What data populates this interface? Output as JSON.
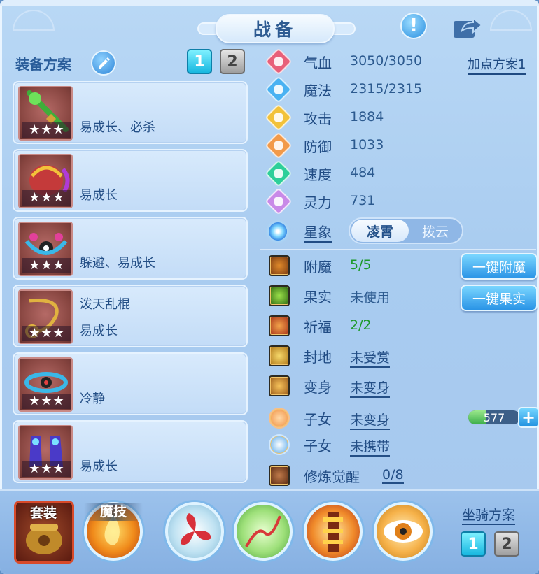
{
  "header": {
    "title": "战备"
  },
  "left": {
    "plan_label": "装备方案",
    "tabs": [
      "1",
      "2"
    ],
    "active_tab": "1",
    "slots": [
      {
        "name": "",
        "tag": "易成长、必杀",
        "stars": "★★★",
        "icon": "green-staff-weapon-icon"
      },
      {
        "name": "",
        "tag": "易成长",
        "stars": "★★★",
        "icon": "jeweled-helmet-icon"
      },
      {
        "name": "",
        "tag": "躲避、易成长",
        "stars": "★★★",
        "icon": "ornate-necklace-icon"
      },
      {
        "name": "泼天乱棍",
        "tag": "易成长",
        "stars": "★★★",
        "icon": "chain-weapon-icon"
      },
      {
        "name": "",
        "tag": "冷静",
        "stars": "★★★",
        "icon": "eye-belt-icon"
      },
      {
        "name": "",
        "tag": "易成长",
        "stars": "★★★",
        "icon": "boots-icon"
      }
    ]
  },
  "stats": {
    "add_plan": "加点方案1",
    "items": [
      {
        "name": "气血",
        "value": "3050/3050",
        "icon": "heart-gem-icon",
        "color": "#e8607a"
      },
      {
        "name": "魔法",
        "value": "2315/2315",
        "icon": "mana-gem-icon",
        "color": "#4ab2f2"
      },
      {
        "name": "攻击",
        "value": "1884",
        "icon": "sword-gem-icon",
        "color": "#f2c23a"
      },
      {
        "name": "防御",
        "value": "1033",
        "icon": "shield-gem-icon",
        "color": "#f29a4a"
      },
      {
        "name": "速度",
        "value": "484",
        "icon": "speed-gem-icon",
        "color": "#2ecf9a"
      },
      {
        "name": "灵力",
        "value": "731",
        "icon": "spirit-gem-icon",
        "color": "#c98ae8"
      }
    ],
    "xingxiang": {
      "label": "星象",
      "options": [
        "凌霄",
        "拨云"
      ],
      "selected": "凌霄"
    }
  },
  "extras": [
    {
      "name": "附魔",
      "value": "5/5",
      "style": "green"
    },
    {
      "name": "果实",
      "value": "未使用",
      "style": "plain"
    },
    {
      "name": "祈福",
      "value": "2/2",
      "style": "green"
    },
    {
      "name": "封地",
      "value": "未受赏",
      "style": "underline"
    },
    {
      "name": "变身",
      "value": "未变身",
      "style": "underline"
    },
    {
      "name": "子女",
      "value": "未变身",
      "style": "underline"
    },
    {
      "name": "子女",
      "value": "未携带",
      "style": "underline"
    },
    {
      "name": "修炼觉醒",
      "value": "0/8",
      "style": "underline"
    }
  ],
  "actions": {
    "enchant": "一键附魔",
    "fruit": "一键果实"
  },
  "exp": {
    "value": "577",
    "fill": 0.35
  },
  "bottom": {
    "suit_label": "套装",
    "soul_label": "魔技",
    "mount_label": "坐骑方案",
    "mount_tabs": [
      "1",
      "2"
    ]
  }
}
